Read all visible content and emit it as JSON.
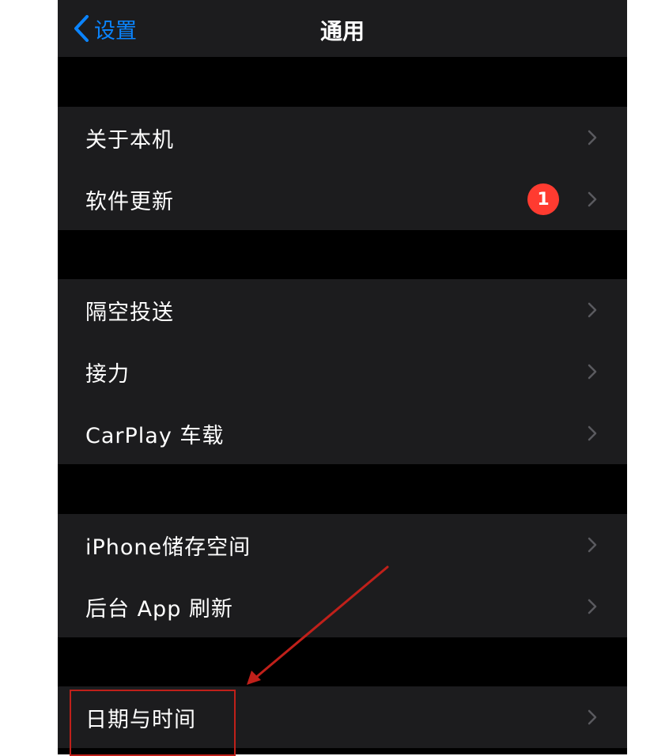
{
  "navbar": {
    "back_label": "设置",
    "title": "通用"
  },
  "groups": [
    {
      "items": [
        {
          "label": "关于本机"
        },
        {
          "label": "软件更新",
          "badge": "1"
        }
      ]
    },
    {
      "items": [
        {
          "label": "隔空投送"
        },
        {
          "label": "接力"
        },
        {
          "label": "CarPlay 车载"
        }
      ]
    },
    {
      "items": [
        {
          "label": "iPhone储存空间"
        },
        {
          "label": "后台 App 刷新"
        }
      ]
    },
    {
      "items": [
        {
          "label": "日期与时间"
        }
      ]
    }
  ],
  "colors": {
    "accent": "#0a84ff",
    "badge": "#ff3b30",
    "annotation": "#c0201a"
  },
  "icons": {
    "back": "chevron-left-icon",
    "disclosure": "chevron-right-icon"
  }
}
